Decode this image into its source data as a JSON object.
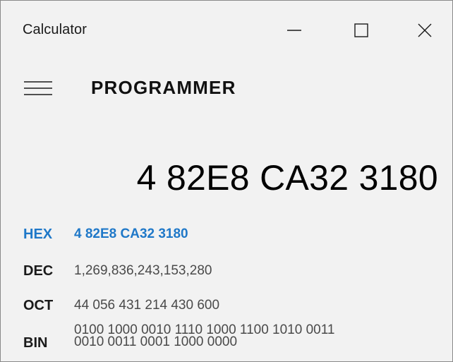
{
  "window": {
    "title": "Calculator",
    "controls": {
      "minimize_icon": "minimize-icon",
      "maximize_icon": "maximize-icon",
      "close_icon": "close-icon"
    }
  },
  "header": {
    "menu_icon": "hamburger-menu-icon",
    "mode": "PROGRAMMER"
  },
  "display": {
    "value": "4 82E8 CA32 3180"
  },
  "radix": [
    {
      "label": "HEX",
      "value": "4 82E8 CA32 3180",
      "selected": true
    },
    {
      "label": "DEC",
      "value": "1,269,836,243,153,280",
      "selected": false
    },
    {
      "label": "OCT",
      "value": "44 056 431 214 430 600",
      "selected": false
    },
    {
      "label": "BIN",
      "value_line1": "0100 1000 0010 1110 1000 1100 1010 0011",
      "value_line2": "0010 0011 0001 1000 0000",
      "selected": false
    }
  ],
  "colors": {
    "accent": "#1f78c8",
    "background": "#f2f2f2",
    "text": "#1a1a1a",
    "secondary_text": "#4a4a4a"
  }
}
